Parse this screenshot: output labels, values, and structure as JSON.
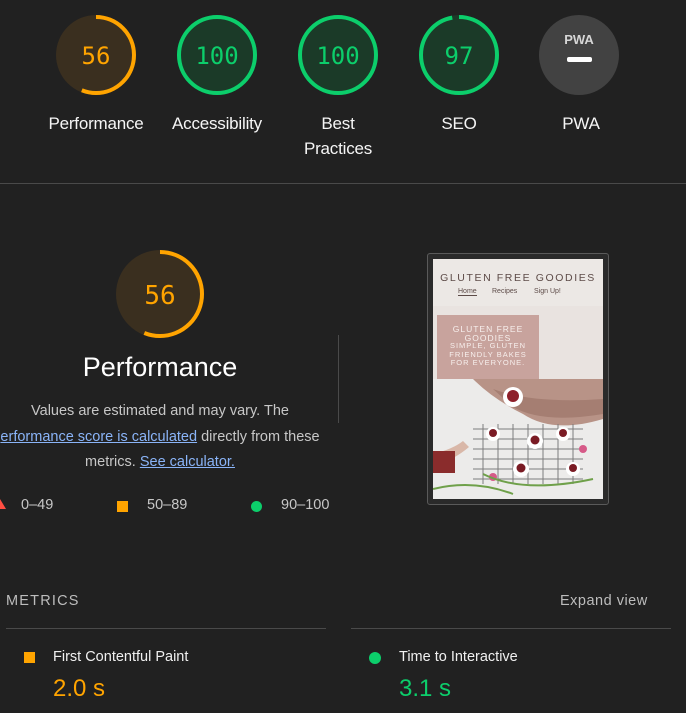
{
  "colors": {
    "average": "#ffa400",
    "pass": "#0cce6b",
    "fail": "#ff4e42",
    "link": "#8ab4f8"
  },
  "categories": [
    {
      "label": "Performance",
      "score": 56,
      "rating": "average"
    },
    {
      "label": "Accessibility",
      "score": 100,
      "rating": "pass"
    },
    {
      "label": "Best\nPractices",
      "score": 100,
      "rating": "pass"
    },
    {
      "label": "SEO",
      "score": 97,
      "rating": "pass"
    },
    {
      "label": "PWA",
      "score": null,
      "rating": "na",
      "badge": "PWA"
    }
  ],
  "performance": {
    "score": "56",
    "title": "Performance",
    "desc_prefix": "Values are estimated and may vary. The",
    "desc_link1": "erformance score is calculated",
    "desc_middle": "directly from these",
    "desc_prefix2": "metrics.",
    "desc_link2": "See calculator."
  },
  "legend": {
    "fail": "0–49",
    "average": "50–89",
    "pass": "90–100"
  },
  "screenshot": {
    "site_title": "GLUTEN FREE GOODIES",
    "nav": [
      "Home",
      "Recipes",
      "Sign Up!"
    ],
    "hero_lines": [
      "GLUTEN FREE",
      "GOODIES",
      "SIMPLE, GLUTEN",
      "FRIENDLY BAKES",
      "FOR EVERYONE."
    ]
  },
  "metrics": {
    "header": "METRICS",
    "expand_label": "Expand view",
    "items": [
      {
        "name": "First Contentful Paint",
        "value": "2.0 s",
        "rating": "average"
      },
      {
        "name": "Time to Interactive",
        "value": "3.1 s",
        "rating": "pass"
      }
    ]
  }
}
